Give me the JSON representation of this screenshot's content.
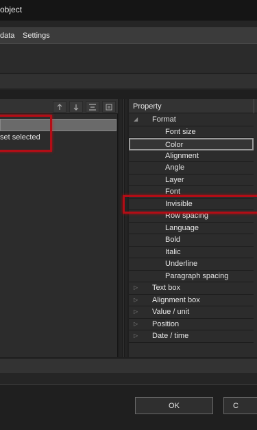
{
  "window": {
    "title": "object"
  },
  "menu": {
    "items": [
      "data",
      "Settings"
    ]
  },
  "left_panel": {
    "selected_row_text": "set selected",
    "toolbar_icons": [
      "arrow-up-icon",
      "arrow-down-icon",
      "spacing-icon",
      "list-icon"
    ]
  },
  "property_panel": {
    "header": "Property",
    "groups": [
      {
        "label": "Format",
        "expanded": true
      },
      {
        "label": "Text box",
        "expanded": false
      },
      {
        "label": "Alignment box",
        "expanded": false
      },
      {
        "label": "Value / unit",
        "expanded": false
      },
      {
        "label": "Position",
        "expanded": false
      },
      {
        "label": "Date / time",
        "expanded": false
      }
    ],
    "format_items": [
      "Font size",
      "Color",
      "Alignment",
      "Angle",
      "Layer",
      "Font",
      "Invisible",
      "Row spacing",
      "Language",
      "Bold",
      "Italic",
      "Underline",
      "Paragraph spacing"
    ],
    "selected_item": "Color",
    "highlighted_item": "Invisible"
  },
  "buttons": {
    "ok": "OK",
    "cancel": "C"
  },
  "colors": {
    "highlight_red": "#b30d16",
    "background": "#252525",
    "panel": "#2c2c2c"
  }
}
